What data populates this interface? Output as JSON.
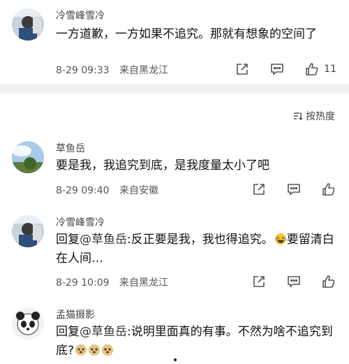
{
  "top_comment": {
    "username": "冷雪峰雪冷",
    "text": "一方道歉，一方如果不追究。那就有想象的空间了",
    "date": "8-29 09:33",
    "location": "来自黑龙江",
    "like_count": "11",
    "icons": [
      "share-icon",
      "comment-icon",
      "like-icon"
    ]
  },
  "sort_bar": {
    "label": "按热度",
    "icon": "sort-icon"
  },
  "comments": [
    {
      "username": "草鱼岳",
      "text": "要是我，我追究到底，是我度量太小了吧",
      "date": "8-29 09:40",
      "location": "来自安徽"
    },
    {
      "username": "冷雪峰雪冷",
      "reply_prefix": "回复",
      "mention": "@草鱼岳",
      "text": ":反正要是我，我也得追究。",
      "text_after_emoji": "要留清白在人间…",
      "date": "8-29 10:09",
      "location": "来自黑龙江"
    },
    {
      "username": "孟猫摄影",
      "reply_prefix": "回复",
      "mention": "@草鱼岳",
      "text": ":说明里面真的有事。不然为啥不追究到底?",
      "emoji_count": 3
    }
  ],
  "colors": {
    "divider": "#f2f2f2",
    "text": "#111111",
    "meta": "#555555"
  }
}
